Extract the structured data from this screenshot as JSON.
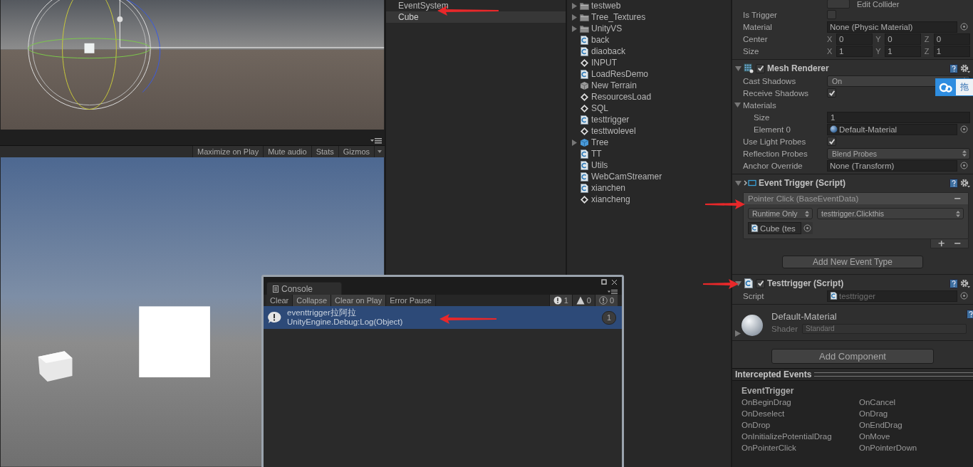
{
  "game_toolbar": {
    "buttons": [
      "Maximize on Play",
      "Mute audio",
      "Stats",
      "Gizmos"
    ]
  },
  "hierarchy": {
    "items": [
      {
        "label": "EventSystem",
        "selected": false
      },
      {
        "label": "Cube",
        "selected": true
      }
    ]
  },
  "project": {
    "items": [
      {
        "label": "testweb",
        "kind": "folder"
      },
      {
        "label": "Tree_Textures",
        "kind": "folder"
      },
      {
        "label": "UnityVS",
        "kind": "folder"
      },
      {
        "label": "back",
        "kind": "script"
      },
      {
        "label": "diaoback",
        "kind": "script"
      },
      {
        "label": "INPUT",
        "kind": "scene"
      },
      {
        "label": "LoadResDemo",
        "kind": "script"
      },
      {
        "label": "New Terrain",
        "kind": "terrain"
      },
      {
        "label": "ResourcesLoad",
        "kind": "scene"
      },
      {
        "label": "SQL",
        "kind": "scene"
      },
      {
        "label": "testtrigger",
        "kind": "script"
      },
      {
        "label": "testtwolevel",
        "kind": "scene"
      },
      {
        "label": "Tree",
        "kind": "prefab"
      },
      {
        "label": "TT",
        "kind": "script"
      },
      {
        "label": "Utils",
        "kind": "script"
      },
      {
        "label": "WebCamStreamer",
        "kind": "script"
      },
      {
        "label": "xianchen",
        "kind": "script"
      },
      {
        "label": "xiancheng",
        "kind": "scene"
      }
    ]
  },
  "inspector": {
    "edit_collider": {
      "label": "Edit Collider"
    },
    "collider_fields": [
      {
        "kind": "checkbox",
        "label": "Is Trigger",
        "checked": false
      },
      {
        "kind": "object",
        "label": "Material",
        "value": "None (Physic Material)",
        "disabled": false
      },
      {
        "kind": "vector",
        "label": "Center",
        "axes": [
          {
            "axis": "X",
            "value": "0"
          },
          {
            "axis": "Y",
            "value": "0"
          },
          {
            "axis": "Z",
            "value": "0"
          }
        ]
      },
      {
        "kind": "vector",
        "label": "Size",
        "axes": [
          {
            "axis": "X",
            "value": "1"
          },
          {
            "axis": "Y",
            "value": "1"
          },
          {
            "axis": "Z",
            "value": "1"
          }
        ]
      }
    ],
    "components": [
      {
        "kind": "renderer",
        "title": "Mesh Renderer",
        "enabled": true,
        "expanded": true,
        "fields": [
          {
            "kind": "dropdown",
            "label": "Cast Shadows",
            "value": "On"
          },
          {
            "kind": "checkbox",
            "label": "Receive Shadows",
            "checked": true
          },
          {
            "kind": "foldout",
            "label": "Materials",
            "expanded": true,
            "children": [
              {
                "kind": "number",
                "label": "Size",
                "value": "1"
              },
              {
                "kind": "material_slot",
                "label": "Element 0",
                "value": "Default-Material",
                "disabled": false
              }
            ]
          },
          {
            "kind": "checkbox",
            "label": "Use Light Probes",
            "checked": true
          },
          {
            "kind": "dropdown",
            "label": "Reflection Probes",
            "value": "Blend Probes"
          },
          {
            "kind": "object",
            "label": "Anchor Override",
            "value": "None (Transform)",
            "disabled": false
          }
        ]
      },
      {
        "kind": "event_trigger",
        "title": "Event Trigger (Script)",
        "expanded": true,
        "entries": [
          {
            "title": "Pointer Click (BaseEventData)",
            "remove": "−",
            "mode": "Runtime Only",
            "function": "testtrigger.Clickthis",
            "target": "Cube (tes"
          }
        ],
        "add": "+",
        "remove": "−",
        "add_button": "Add New Event Type"
      },
      {
        "kind": "script",
        "title": "Testtrigger (Script)",
        "enabled": true,
        "expanded": true,
        "fields": [
          {
            "kind": "script_ref",
            "label": "Script",
            "value": "testtrigger",
            "disabled": true
          }
        ]
      },
      {
        "kind": "material",
        "title": "Default-Material",
        "expanded": false,
        "shader_label": "Shader",
        "shader": "Standard"
      }
    ],
    "add_component": "Add Component"
  },
  "intercepted_events": {
    "title": "Intercepted Events",
    "class_name": "EventTrigger",
    "rows": [
      {
        "left": "OnBeginDrag",
        "right": "OnCancel"
      },
      {
        "left": "OnDeselect",
        "right": "OnDrag"
      },
      {
        "left": "OnDrop",
        "right": "OnEndDrag"
      },
      {
        "left": "OnInitializePotentialDrag",
        "right": "OnMove"
      },
      {
        "left": "OnPointerClick",
        "right": "OnPointerDown"
      }
    ]
  },
  "console": {
    "tab": "Console",
    "toolbar": [
      {
        "label": "Clear",
        "selected": false
      },
      {
        "label": "Collapse",
        "selected": true
      },
      {
        "label": "Clear on Play",
        "selected": true
      },
      {
        "label": "Error Pause",
        "selected": false
      }
    ],
    "counters": [
      {
        "kind": "info",
        "count": "1"
      },
      {
        "kind": "warning",
        "count": "0"
      },
      {
        "kind": "error",
        "count": "0"
      }
    ],
    "entries": [
      {
        "message": "eventtrigger拉阿拉",
        "trace": "UnityEngine.Debug:Log(Object)",
        "count": "1",
        "selected": true
      }
    ]
  },
  "floating_widget": {
    "label": "拖"
  }
}
